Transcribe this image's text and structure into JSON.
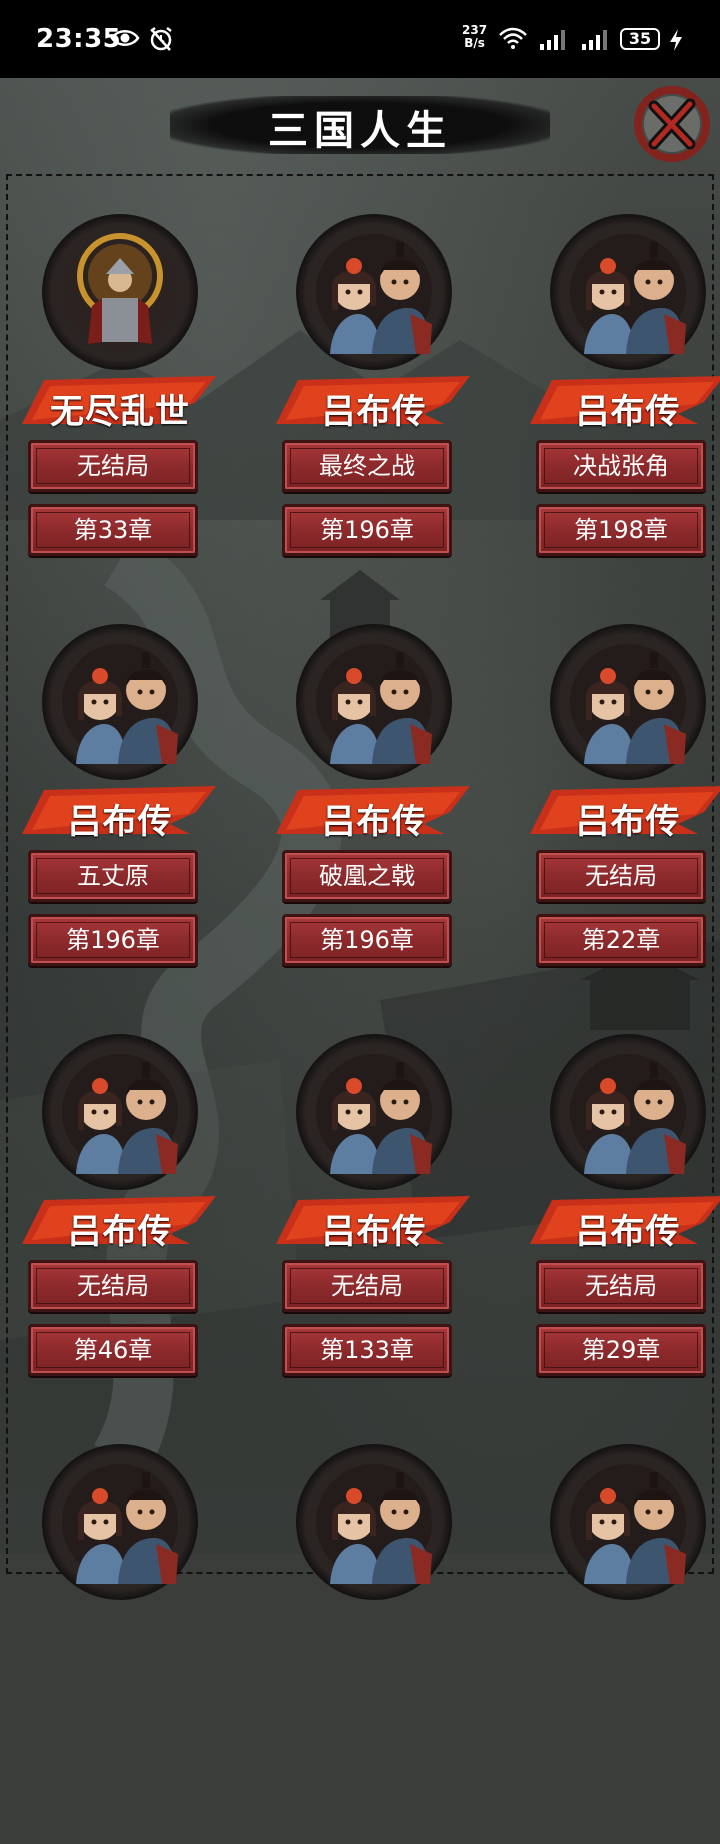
{
  "status_bar": {
    "time": "23:35",
    "net_speed_value": "237",
    "net_speed_unit": "B/s",
    "battery": "35"
  },
  "header": {
    "title": "三国人生"
  },
  "cards": [
    {
      "name": "无尽乱世",
      "ending": "无结局",
      "chapter": "第33章",
      "portrait": "armored-general"
    },
    {
      "name": "吕布传",
      "ending": "最终之战",
      "chapter": "第196章",
      "portrait": "couple"
    },
    {
      "name": "吕布传",
      "ending": "决战张角",
      "chapter": "第198章",
      "portrait": "couple"
    },
    {
      "name": "吕布传",
      "ending": "五丈原",
      "chapter": "第196章",
      "portrait": "couple"
    },
    {
      "name": "吕布传",
      "ending": "破凰之戟",
      "chapter": "第196章",
      "portrait": "couple"
    },
    {
      "name": "吕布传",
      "ending": "无结局",
      "chapter": "第22章",
      "portrait": "couple"
    },
    {
      "name": "吕布传",
      "ending": "无结局",
      "chapter": "第46章",
      "portrait": "couple"
    },
    {
      "name": "吕布传",
      "ending": "无结局",
      "chapter": "第133章",
      "portrait": "couple"
    },
    {
      "name": "吕布传",
      "ending": "无结局",
      "chapter": "第29章",
      "portrait": "couple"
    },
    {
      "name": "",
      "ending": "",
      "chapter": "",
      "portrait": "couple"
    },
    {
      "name": "",
      "ending": "",
      "chapter": "",
      "portrait": "couple"
    },
    {
      "name": "",
      "ending": "",
      "chapter": "",
      "portrait": "couple"
    }
  ],
  "colors": {
    "accent_red": "#a9383a",
    "banner_red": "#d83a1e",
    "status_bg": "#000000"
  }
}
